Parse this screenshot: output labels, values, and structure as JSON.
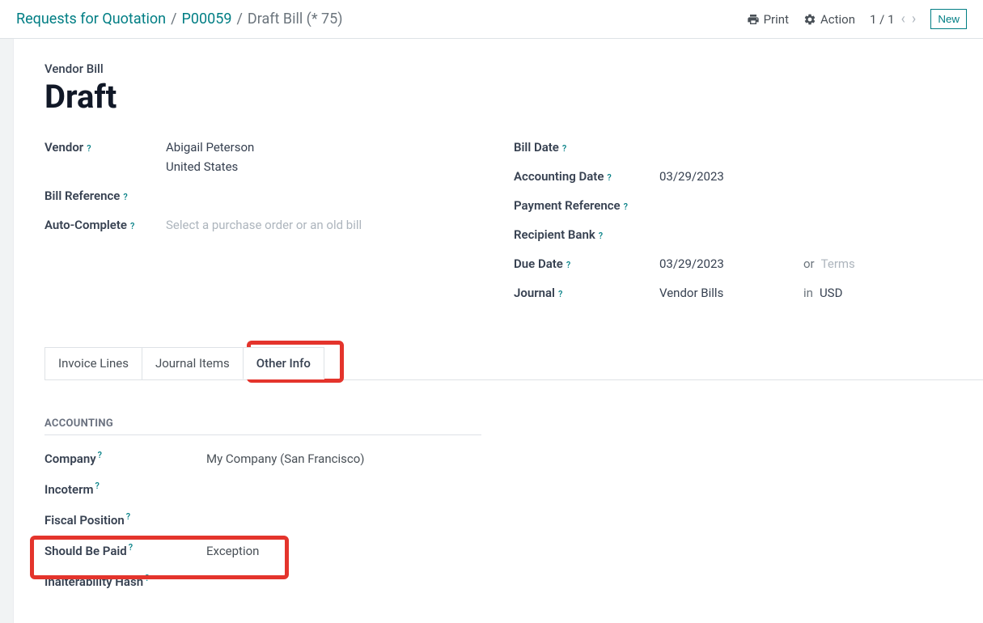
{
  "breadcrumb": {
    "root": "Requests for Quotation",
    "po": "P00059",
    "current": "Draft Bill (* 75)"
  },
  "topbar": {
    "print": "Print",
    "action": "Action",
    "pager": "1 / 1",
    "new": "New"
  },
  "header": {
    "section_label": "Vendor Bill",
    "title": "Draft"
  },
  "left_fields": {
    "vendor_label": "Vendor",
    "vendor_name": "Abigail Peterson",
    "vendor_country": "United States",
    "bill_ref_label": "Bill Reference",
    "auto_complete_label": "Auto-Complete",
    "auto_complete_placeholder": "Select a purchase order or an old bill"
  },
  "right_fields": {
    "bill_date_label": "Bill Date",
    "accounting_date_label": "Accounting Date",
    "accounting_date_value": "03/29/2023",
    "payment_ref_label": "Payment Reference",
    "recipient_bank_label": "Recipient Bank",
    "due_date_label": "Due Date",
    "due_date_value": "03/29/2023",
    "due_date_or": "or",
    "due_date_terms": "Terms",
    "journal_label": "Journal",
    "journal_value": "Vendor Bills",
    "journal_in": "in",
    "journal_currency": "USD"
  },
  "tabs": {
    "invoice_lines": "Invoice Lines",
    "journal_items": "Journal Items",
    "other_info": "Other Info"
  },
  "accounting": {
    "title": "Accounting",
    "company_label": "Company",
    "company_value": "My Company (San Francisco)",
    "incoterm_label": "Incoterm",
    "fiscal_label": "Fiscal Position",
    "should_paid_label": "Should Be Paid",
    "should_paid_value": "Exception",
    "hash_label": "Inalterability Hash"
  }
}
